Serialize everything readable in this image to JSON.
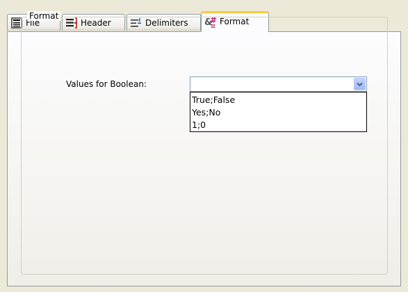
{
  "tabs": [
    {
      "label": "File",
      "icon": "file-list-icon",
      "active": false
    },
    {
      "label": "Header",
      "icon": "header-icon",
      "active": false
    },
    {
      "label": "Delimiters",
      "icon": "delimiters-icon",
      "active": false
    },
    {
      "label": "Format",
      "icon": "format-icon",
      "active": true
    }
  ],
  "group": {
    "title": "Format"
  },
  "boolean_field": {
    "label": "Values for Boolean:",
    "value": "",
    "options": [
      "True;False",
      "Yes;No",
      "1;0"
    ]
  },
  "colors": {
    "active_tab_accent": "#ffc73c",
    "combo_border": "#7f9db9"
  }
}
